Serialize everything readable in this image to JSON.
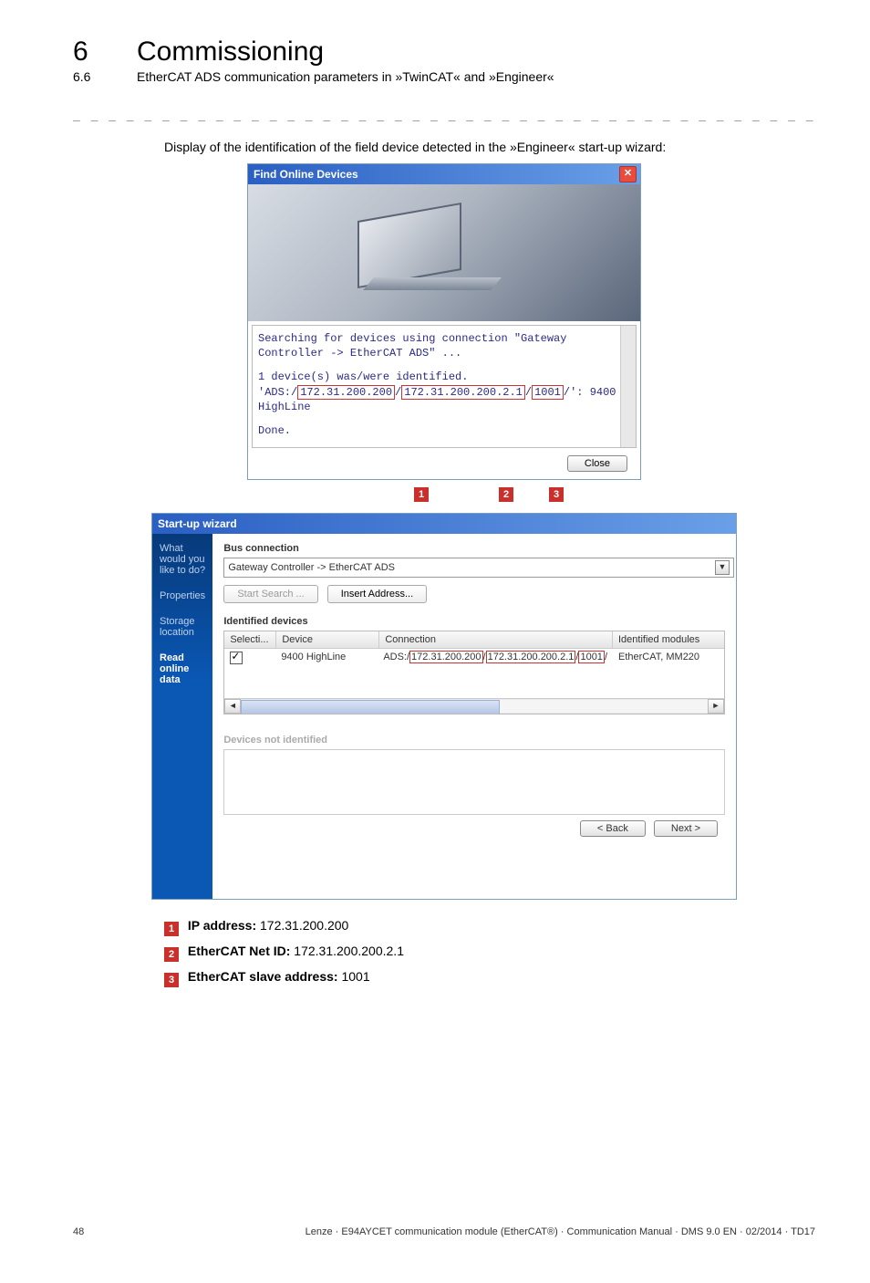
{
  "header": {
    "chapter_num": "6",
    "chapter_title": "Commissioning",
    "sub_num": "6.6",
    "sub_title": "EtherCAT ADS communication parameters in »TwinCAT« and »Engineer«"
  },
  "dash_line": "_ _ _ _ _ _ _ _ _ _ _ _ _ _ _ _ _ _ _ _ _ _ _ _ _ _ _ _ _ _ _ _ _ _ _ _ _ _ _ _ _ _ _ _ _ _ _ _ _ _ _ _ _ _ _ _ _ _ _ _ _ _ _ _",
  "intro_text": "Display of the identification of the field device detected in the »Engineer« start-up wizard:",
  "find_dialog": {
    "title": "Find Online Devices",
    "close_x": "✕",
    "log_line1": "Searching for devices using connection \"Gateway",
    "log_line2": "Controller -> EtherCAT ADS\" ...",
    "log_line3a": "1 device(s) was/were identified.",
    "log_line3b_prefix": "'ADS:/",
    "log_ip": "172.31.200.200",
    "log_sep1": "/",
    "log_netid": "172.31.200.200.2.1",
    "log_sep2": "/",
    "log_slave": "1001",
    "log_line3b_suffix": "/': 9400",
    "log_line4": "HighLine",
    "log_done": "Done.",
    "close_btn": "Close"
  },
  "markers": {
    "m1": "1",
    "m2": "2",
    "m3": "3"
  },
  "wizard": {
    "title": "Start-up wizard",
    "side": {
      "what": "What would you like to do?",
      "properties": "Properties",
      "storage": "Storage location",
      "read": "Read online data"
    },
    "bus_label": "Bus connection",
    "combo_text": "Gateway Controller -> EtherCAT ADS",
    "start_search": "Start Search ...",
    "insert_addr": "Insert Address...",
    "identified_label": "Identified devices",
    "th_sel": "Selecti...",
    "th_dev": "Device",
    "th_conn": "Connection",
    "th_idm": "Identified modules",
    "row_device": "9400 HighLine",
    "row_conn_prefix": "ADS:/",
    "row_ip": "172.31.200.200",
    "row_sep1": "/",
    "row_netid": "172.31.200.200.2.1",
    "row_sep2": "/",
    "row_slave": "1001",
    "row_conn_suffix": "/",
    "row_idm": "EtherCAT, MM220",
    "not_identified": "Devices not identified",
    "back_btn": "< Back",
    "next_btn": "Next >"
  },
  "legend": {
    "l1_label": "IP address:",
    "l1_val": " 172.31.200.200",
    "l2_label": "EtherCAT Net ID:",
    "l2_val": " 172.31.200.200.2.1",
    "l3_label": "EtherCAT slave address:",
    "l3_val": " 1001"
  },
  "footer": {
    "page": "48",
    "text": "Lenze · E94AYCET communication module (EtherCAT®) · Communication Manual · DMS 9.0 EN · 02/2014 · TD17"
  }
}
